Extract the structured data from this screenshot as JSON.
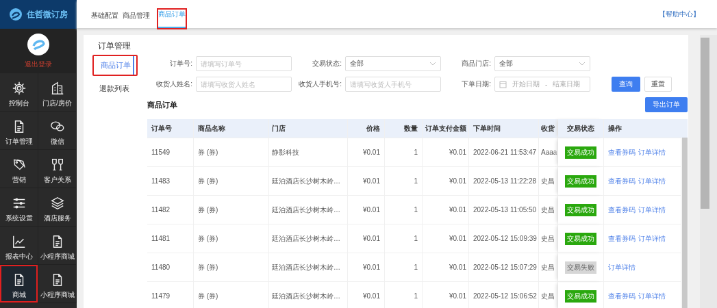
{
  "logo": {
    "title": "住哲微订房"
  },
  "account": {
    "logout": "退出登录"
  },
  "sidebar": {
    "items": [
      {
        "label": "控制台",
        "selected": false
      },
      {
        "label": "门店/房价",
        "selected": false
      },
      {
        "label": "订单管理",
        "selected": false
      },
      {
        "label": "微信",
        "selected": false
      },
      {
        "label": "营销",
        "selected": false
      },
      {
        "label": "客户关系",
        "selected": false
      },
      {
        "label": "系统设置",
        "selected": false
      },
      {
        "label": "酒店服务",
        "selected": false
      },
      {
        "label": "报表中心",
        "selected": false
      },
      {
        "label": "小程序商城",
        "selected": false
      },
      {
        "label": "商城",
        "selected": true
      },
      {
        "label": "小程序商城",
        "selected": false
      }
    ]
  },
  "tabs": [
    {
      "label": "基础配置",
      "selected": false
    },
    {
      "label": "商品管理",
      "selected": false
    },
    {
      "label": "商品订单",
      "selected": true
    }
  ],
  "help_link": "【帮助中心】",
  "panel": {
    "title": "订单管理",
    "subnav": [
      {
        "label": "商品订单",
        "selected": true
      },
      {
        "label": "退款列表",
        "selected": false
      }
    ],
    "filters": [
      {
        "kind": "text",
        "label": "订单号:",
        "placeholder": "请填写订单号"
      },
      {
        "kind": "select",
        "label": "交易状态:",
        "value": "全部"
      },
      {
        "kind": "select",
        "label": "商品门店:",
        "value": "全部"
      },
      {
        "kind": "text",
        "label": "收货人姓名:",
        "placeholder": "请填写收货人姓名"
      },
      {
        "kind": "text",
        "label": "收货人手机号:",
        "placeholder": "请填写收货人手机号"
      },
      {
        "kind": "daterange",
        "label": "下单日期:",
        "start_placeholder": "开始日期",
        "separator": "-",
        "end_placeholder": "结束日期"
      }
    ],
    "buttons": {
      "search": "查询",
      "reset": "重置"
    },
    "section_title": "商品订单",
    "export_button": "导出订单"
  },
  "table": {
    "columns": [
      "订单号",
      "商品名称",
      "门店",
      "价格",
      "数量",
      "订单支付金额",
      "下单时间",
      "收货",
      "交易状态",
      "操作"
    ],
    "rows": [
      {
        "id": "11549",
        "product": "券 (券)",
        "store": "静影科技",
        "price": "¥0.01",
        "qty": "1",
        "paid": "¥0.01",
        "time": "2022-06-21 11:53:47",
        "recipient": "Aaaa",
        "status": {
          "kind": "success",
          "label": "交易成功"
        },
        "actions": [
          "查看券码",
          "订单详情"
        ]
      },
      {
        "id": "11483",
        "product": "券 (券)",
        "store": "廷泊酒店长沙树木岭…",
        "price": "¥0.01",
        "qty": "1",
        "paid": "¥0.01",
        "time": "2022-05-13 11:22:28",
        "recipient": "史昌",
        "status": {
          "kind": "success",
          "label": "交易成功"
        },
        "actions": [
          "查看券码",
          "订单详情"
        ]
      },
      {
        "id": "11482",
        "product": "券 (券)",
        "store": "廷泊酒店长沙树木岭…",
        "price": "¥0.01",
        "qty": "1",
        "paid": "¥0.01",
        "time": "2022-05-13 11:05:50",
        "recipient": "史昌",
        "status": {
          "kind": "success",
          "label": "交易成功"
        },
        "actions": [
          "查看券码",
          "订单详情"
        ]
      },
      {
        "id": "11481",
        "product": "券 (券)",
        "store": "廷泊酒店长沙树木岭…",
        "price": "¥0.01",
        "qty": "1",
        "paid": "¥0.01",
        "time": "2022-05-12 15:09:39",
        "recipient": "史昌",
        "status": {
          "kind": "success",
          "label": "交易成功"
        },
        "actions": [
          "查看券码",
          "订单详情"
        ]
      },
      {
        "id": "11480",
        "product": "券 (券)",
        "store": "廷泊酒店长沙树木岭…",
        "price": "¥0.01",
        "qty": "1",
        "paid": "¥0.01",
        "time": "2022-05-12 15:07:29",
        "recipient": "史昌",
        "status": {
          "kind": "failed",
          "label": "交易失败"
        },
        "actions": [
          "订单详情"
        ]
      },
      {
        "id": "11479",
        "product": "券 (券)",
        "store": "廷泊酒店长沙树木岭…",
        "price": "¥0.01",
        "qty": "1",
        "paid": "¥0.01",
        "time": "2022-05-12 15:06:52",
        "recipient": "史昌",
        "status": {
          "kind": "success",
          "label": "交易成功"
        },
        "actions": [
          "查看券码",
          "订单详情"
        ]
      }
    ]
  }
}
